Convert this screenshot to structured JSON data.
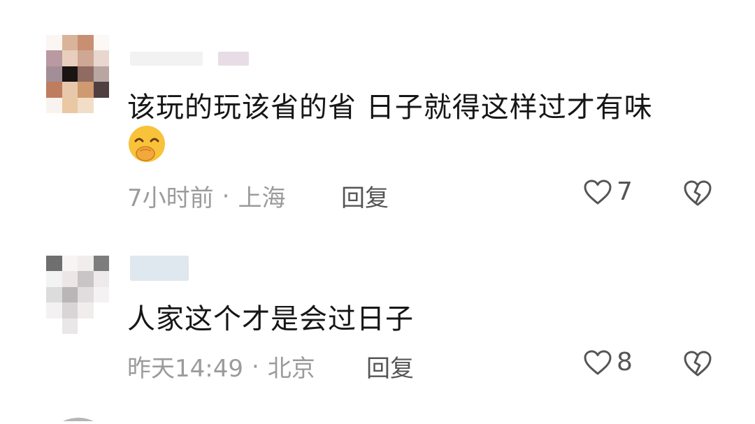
{
  "comments": [
    {
      "text": "该玩的玩该省的省 日子就得这样过才有味",
      "has_emoji": true,
      "time": "7小时前",
      "separator": "·",
      "location": "上海",
      "reply_label": "回复",
      "likes": "7"
    },
    {
      "text": "人家这个才是会过日子",
      "has_emoji": false,
      "time": "昨天14:49",
      "separator": "·",
      "location": "北京",
      "reply_label": "回复",
      "likes": "8"
    }
  ],
  "icons": {
    "like": "heart-outline-icon",
    "dislike": "broken-heart-icon",
    "emoji": "face-with-hand-over-mouth-emoji"
  }
}
